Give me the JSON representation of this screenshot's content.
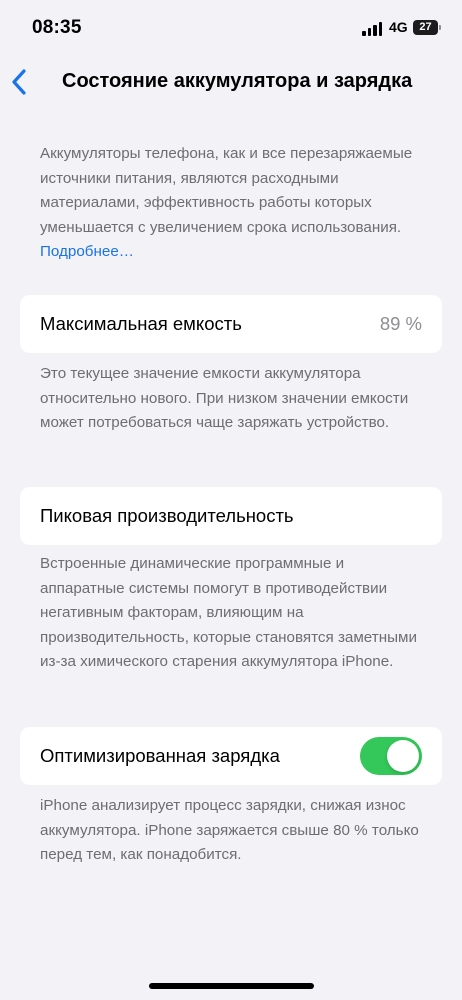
{
  "status_bar": {
    "time": "08:35",
    "network": "4G",
    "battery": "27"
  },
  "nav": {
    "title": "Состояние аккумулятора и зарядка",
    "back_icon": "chevron-left-icon"
  },
  "intro": {
    "text": "Аккумуляторы телефона, как и все перезаряжаемые источники питания, являются расходными материалами, эффективность работы которых уменьшается с увеличением срока использования. ",
    "link": "Подробнее…"
  },
  "max_capacity": {
    "label": "Максимальная емкость",
    "value": "89 %",
    "footnote": "Это текущее значение емкости аккумулятора относительно нового. При низком значении емкости может потребоваться чаще заряжать устройство."
  },
  "peak_performance": {
    "label": "Пиковая производительность",
    "footnote": "Встроенные динамические программные и аппаратные системы помогут в противодействии негативным факторам, влияющим на производительность, которые становятся заметными из-за химического старения аккумулятора iPhone."
  },
  "optimized_charging": {
    "label": "Оптимизированная зарядка",
    "enabled": true,
    "footnote": "iPhone анализирует процесс зарядки, снижая износ аккумулятора. iPhone заряжается свыше 80 % только перед тем, как понадобится."
  },
  "colors": {
    "accent": "#1a73e8",
    "toggle_on": "#34c759",
    "background": "#f2f2f7"
  }
}
